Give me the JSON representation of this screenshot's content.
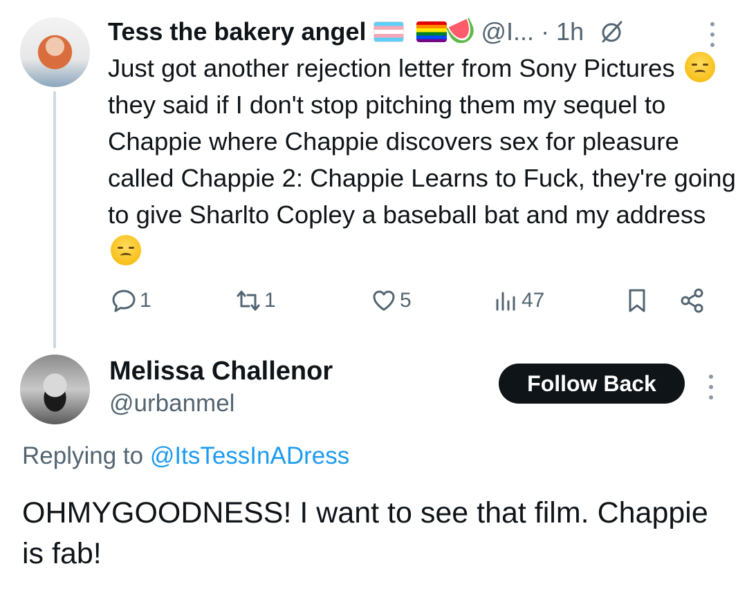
{
  "tweet1": {
    "author_name": "Tess the bakery angel",
    "author_handle": "@I...",
    "time": "· 1h",
    "text_parts": [
      "Just got another rejection letter from Sony Pictures ",
      " they said if I don't stop pitching them my sequel to Chappie where Chappie discovers sex for pleasure called Chappie 2: Chappie Learns to Fuck, they're going to give Sharlto Copley a baseball bat and my address "
    ],
    "name_icons": [
      "transgender-flag-icon",
      "rainbow-flag-icon",
      "watermelon-icon"
    ],
    "actions": {
      "replies": "1",
      "reposts": "1",
      "likes": "5",
      "views": "47"
    }
  },
  "tweet2": {
    "author_name": "Melissa Challenor",
    "author_handle": "@urbanmel",
    "follow_label": "Follow Back",
    "replying_prefix": "Replying to",
    "replying_handle": "@ItsTessInADress",
    "text": "OHMYGOODNESS! I want to see that film. Chappie is fab!"
  },
  "colors": {
    "text_primary": "#0f1419",
    "text_secondary": "#536471",
    "link": "#1d9bf0",
    "thread_line": "#cfd9de",
    "button_bg": "#0f1419"
  }
}
